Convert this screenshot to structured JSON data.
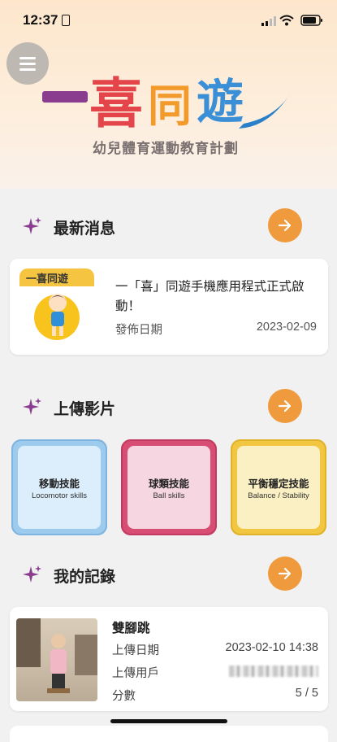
{
  "status_bar": {
    "time": "12:37"
  },
  "header": {
    "logo_chars": [
      "喜",
      "同",
      "遊"
    ],
    "logo_subtitle": "幼兒體育運動教育計劃"
  },
  "news": {
    "section_title": "最新消息",
    "item": {
      "thumb_title": "一喜同遊",
      "title": "一「喜」同遊手機應用程式正式啟動！",
      "date_label": "發佈日期",
      "date": "2023-02-09"
    }
  },
  "upload": {
    "section_title": "上傳影片",
    "skills": [
      {
        "title": "移動技能",
        "subtitle": "Locomotor skills"
      },
      {
        "title": "球類技能",
        "subtitle": "Ball skills"
      },
      {
        "title": "平衡穩定技能",
        "subtitle": "Balance / Stability"
      }
    ]
  },
  "records": {
    "section_title": "我的記錄",
    "item": {
      "title": "雙腳跳",
      "upload_date_label": "上傳日期",
      "upload_date": "2023-02-10 14:38",
      "uploader_label": "上傳用戶",
      "score_label": "分數",
      "score": "5 / 5"
    }
  },
  "colors": {
    "accent_orange": "#ef9a3c",
    "sparkle_purple": "#8a3d8f",
    "tile_blue": "#9ccbee",
    "tile_pink": "#d84d73",
    "tile_yellow": "#f2c640"
  }
}
